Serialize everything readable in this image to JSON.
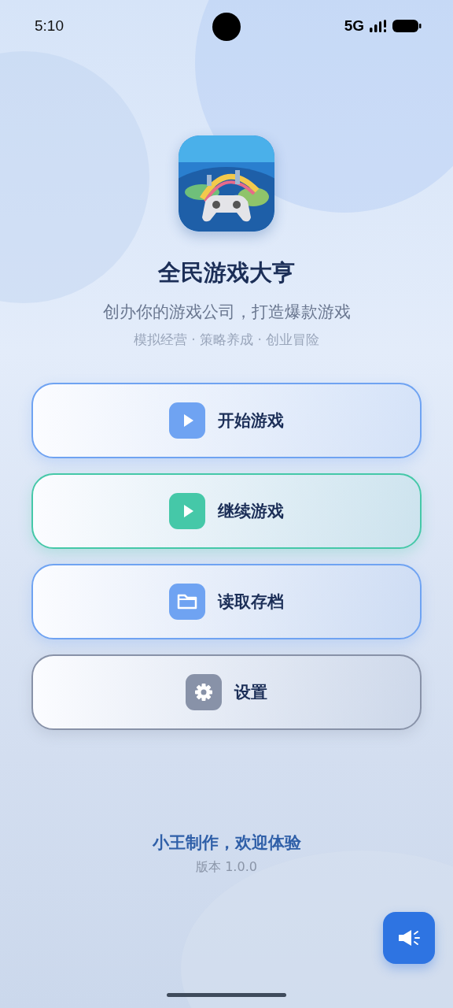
{
  "status_bar": {
    "time": "5:10",
    "network": "5G"
  },
  "title": "全民游戏大亨",
  "subtitle": "创办你的游戏公司，打造爆款游戏",
  "tags": "模拟经营 · 策略养成 · 创业冒险",
  "menu": [
    {
      "label": "开始游戏",
      "kind": "play",
      "color": "#6fa3f2"
    },
    {
      "label": "继续游戏",
      "kind": "play",
      "color": "#45c8a8"
    },
    {
      "label": "读取存档",
      "kind": "folder",
      "color": "#6fa3f2"
    },
    {
      "label": "设置",
      "kind": "gear",
      "color": "#8892a8"
    }
  ],
  "footer": {
    "credit": "小王制作，欢迎体验",
    "version": "版本 1.0.0"
  },
  "fab": {
    "kind": "megaphone"
  }
}
